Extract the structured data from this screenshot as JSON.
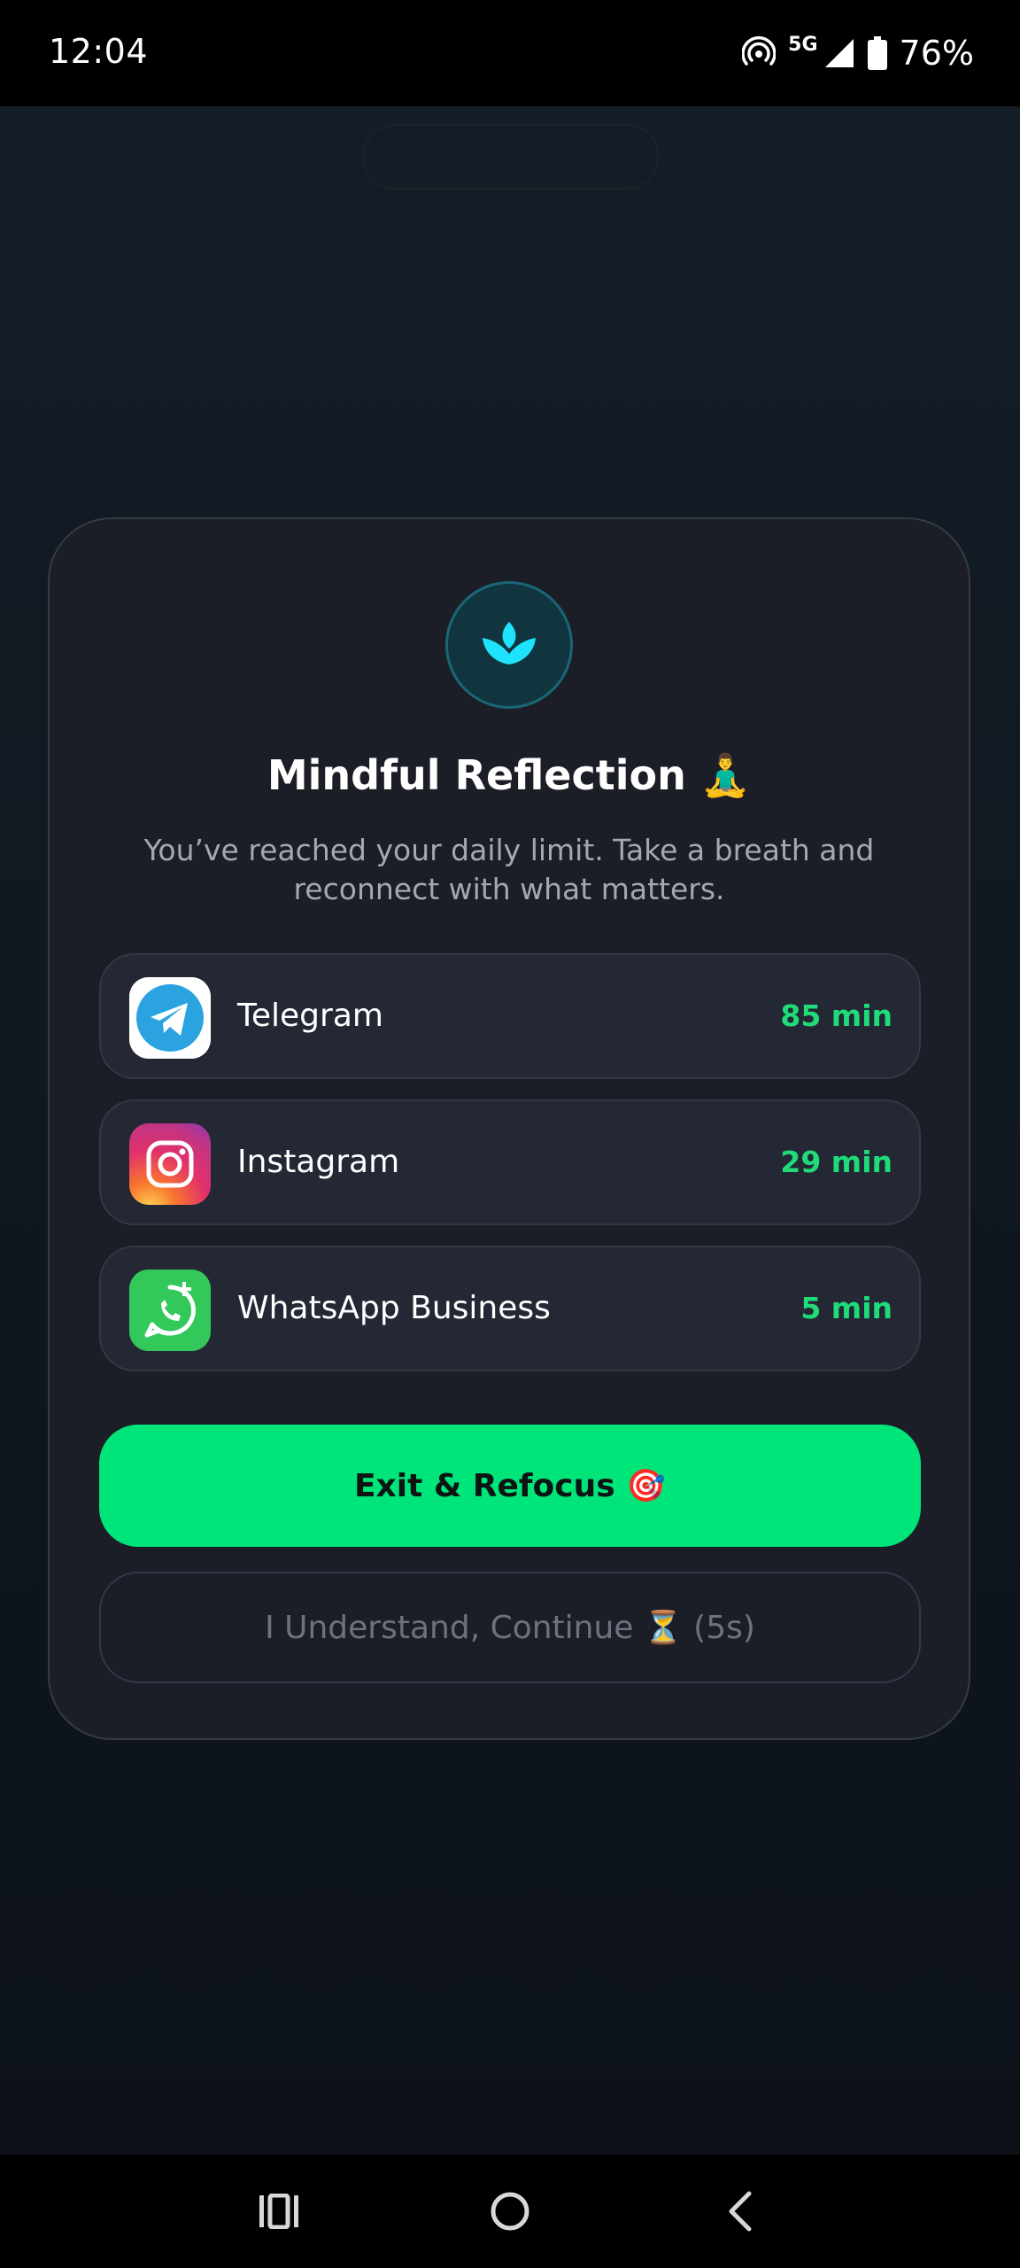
{
  "status_bar": {
    "time": "12:04",
    "network": "5G",
    "battery": "76%"
  },
  "dialog": {
    "icon": "lotus-icon",
    "title": "Mindful Reflection 🧘‍♂️",
    "subtitle": "You’ve reached your daily limit. Take a breath and reconnect with what matters.",
    "apps": [
      {
        "name": "Telegram",
        "time": "85 min",
        "icon": "telegram-icon"
      },
      {
        "name": "Instagram",
        "time": "29 min",
        "icon": "instagram-icon"
      },
      {
        "name": "WhatsApp Business",
        "time": "5 min",
        "icon": "whatsapp-business-icon"
      }
    ],
    "exit_label": "Exit & Refocus 🎯",
    "continue_label": "I Understand, Continue ⏳ (5s)"
  },
  "colors": {
    "accent_green": "#00e57a",
    "time_green": "#1fdc78",
    "lotus_cyan": "#1ee3ff",
    "card_bg": "#1b1e27"
  },
  "nav_bar": {
    "icons": [
      "recents-icon",
      "home-icon",
      "back-icon"
    ]
  }
}
